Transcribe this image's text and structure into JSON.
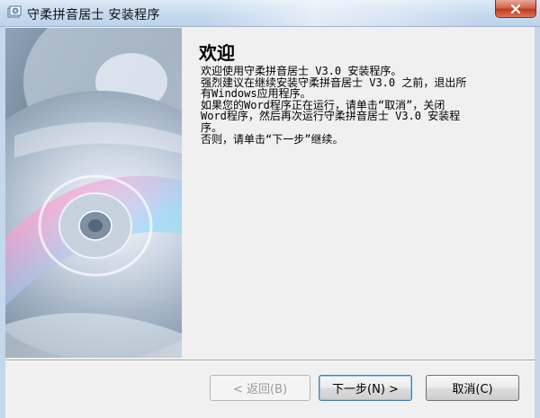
{
  "window": {
    "title": "守柔拼音居士 安装程序",
    "close_icon": "close-x-icon",
    "app_icon": "installer-icon"
  },
  "side_image": {
    "description_icon": "cd-disc-image"
  },
  "main": {
    "heading": "欢迎",
    "lines": [
      "欢迎使用守柔拼音居士 V3.0 安装程序。",
      "强烈建议在继续安装守柔拼音居士 V3.0 之前，退出所",
      "有Windows应用程序。",
      "如果您的Word程序正在运行，请单击“取消”，关闭",
      "Word程序，然后再次运行守柔拼音居士 V3.0 安装程",
      "序。",
      "否则，请单击“下一步”继续。"
    ]
  },
  "buttons": {
    "back": "< 返回(B)",
    "next": "下一步(N) >",
    "cancel": "取消(C)"
  }
}
